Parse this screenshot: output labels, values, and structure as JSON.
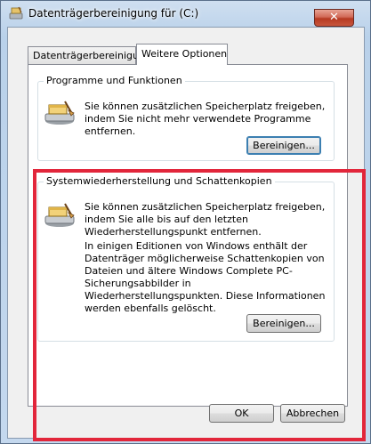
{
  "window": {
    "title": "Datenträgerbereinigung für  (C:)",
    "close_label": "✕"
  },
  "tabs": [
    {
      "label": "Datenträgerbereinigung"
    },
    {
      "label": "Weitere Optionen"
    }
  ],
  "programs": {
    "title": "Programme und Funktionen",
    "text": "Sie können zusätzlichen Speicherplatz freigeben, indem Sie nicht mehr verwendete Programme entfernen.",
    "button": "Bereinigen..."
  },
  "restore": {
    "title": "Systemwiederherstellung und Schattenkopien",
    "text1": "Sie können zusätzlichen Speicherplatz freigeben, indem Sie alle bis auf den letzten Wiederherstellungspunkt entfernen.",
    "text2": "In einigen Editionen von Windows enthält der Datenträger möglicherweise Schattenkopien von Dateien und ältere Windows Complete PC-Sicherungsabbilder in Wiederherstellungspunkten. Diese Informationen werden ebenfalls gelöscht.",
    "button": "Bereinigen..."
  },
  "footer": {
    "ok": "OK",
    "cancel": "Abbrechen"
  },
  "colors": {
    "highlight": "#e2263b"
  }
}
